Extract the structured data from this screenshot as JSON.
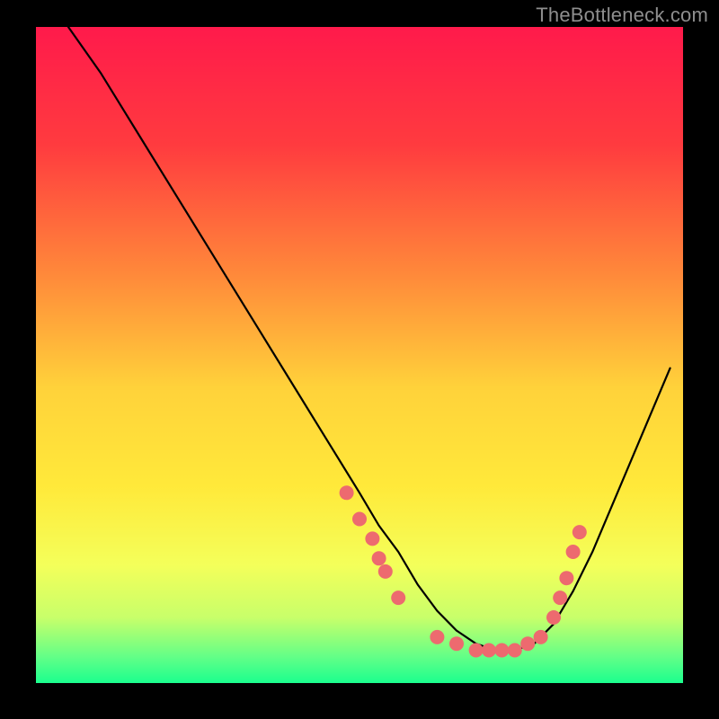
{
  "watermark": "TheBottleneck.com",
  "chart_data": {
    "type": "line",
    "title": "",
    "xlabel": "",
    "ylabel": "",
    "xlim": [
      0,
      100
    ],
    "ylim": [
      0,
      100
    ],
    "background_gradient": [
      {
        "stop": 0.0,
        "color": "#ff1a4b"
      },
      {
        "stop": 0.18,
        "color": "#ff3b3f"
      },
      {
        "stop": 0.38,
        "color": "#ff8a3a"
      },
      {
        "stop": 0.55,
        "color": "#ffd23a"
      },
      {
        "stop": 0.7,
        "color": "#ffe93a"
      },
      {
        "stop": 0.82,
        "color": "#f4ff5a"
      },
      {
        "stop": 0.9,
        "color": "#c8ff6a"
      },
      {
        "stop": 0.96,
        "color": "#63ff87"
      },
      {
        "stop": 1.0,
        "color": "#1bff8e"
      }
    ],
    "series": [
      {
        "name": "bottleneck-curve",
        "color": "#000000",
        "x": [
          5,
          10,
          15,
          20,
          25,
          30,
          35,
          40,
          45,
          50,
          53,
          56,
          59,
          62,
          65,
          68,
          71,
          74,
          77,
          80,
          83,
          86,
          89,
          92,
          95,
          98
        ],
        "y": [
          100,
          93,
          85,
          77,
          69,
          61,
          53,
          45,
          37,
          29,
          24,
          20,
          15,
          11,
          8,
          6,
          5,
          5,
          6,
          9,
          14,
          20,
          27,
          34,
          41,
          48
        ]
      }
    ],
    "markers": {
      "name": "sample-points",
      "color": "#ed6a6f",
      "radius": 8,
      "points": [
        {
          "x": 48,
          "y": 29
        },
        {
          "x": 50,
          "y": 25
        },
        {
          "x": 52,
          "y": 22
        },
        {
          "x": 53,
          "y": 19
        },
        {
          "x": 54,
          "y": 17
        },
        {
          "x": 56,
          "y": 13
        },
        {
          "x": 62,
          "y": 7
        },
        {
          "x": 65,
          "y": 6
        },
        {
          "x": 68,
          "y": 5
        },
        {
          "x": 70,
          "y": 5
        },
        {
          "x": 72,
          "y": 5
        },
        {
          "x": 74,
          "y": 5
        },
        {
          "x": 76,
          "y": 6
        },
        {
          "x": 78,
          "y": 7
        },
        {
          "x": 80,
          "y": 10
        },
        {
          "x": 81,
          "y": 13
        },
        {
          "x": 82,
          "y": 16
        },
        {
          "x": 83,
          "y": 20
        },
        {
          "x": 84,
          "y": 23
        }
      ]
    }
  }
}
